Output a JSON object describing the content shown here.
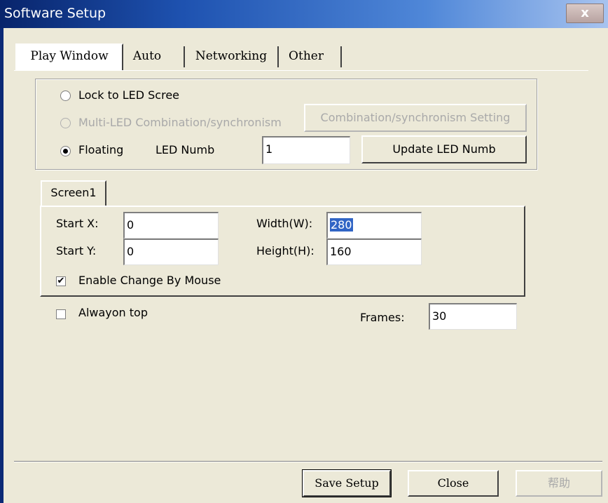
{
  "window": {
    "title": "Software Setup",
    "close_glyph": "x"
  },
  "tabs": [
    "Play Window",
    "Auto",
    "Networking",
    "Other"
  ],
  "display_mode": {
    "lock_label": "Lock to LED Scree",
    "multi_label": "Multi-LED Combination/synchronism",
    "combination_button": "Combination/synchronism Setting",
    "floating_label": "Floating",
    "led_numb_label": "LED Numb",
    "led_numb_value": "1",
    "update_button": "Update LED Numb",
    "selected": "floating"
  },
  "screen_tab": "Screen1",
  "screen": {
    "start_x_label": "Start X:",
    "start_x_value": "0",
    "start_y_label": "Start Y:",
    "start_y_value": "0",
    "width_label": "Width(W):",
    "width_value": "280",
    "height_label": "Height(H):",
    "height_value": "160",
    "enable_mouse_label": "Enable Change By Mouse",
    "enable_mouse_checked": true,
    "check_glyph": "✔"
  },
  "always_on_top_label": "Alwayon top",
  "always_on_top_checked": false,
  "frames_label": "Frames:",
  "frames_value": "30",
  "buttons": {
    "save": "Save Setup",
    "close": "Close",
    "help": "帮助"
  },
  "colors": {
    "title_gradient_start": "#08246b",
    "selection": "#3165c5",
    "face": "#ece9d8"
  }
}
